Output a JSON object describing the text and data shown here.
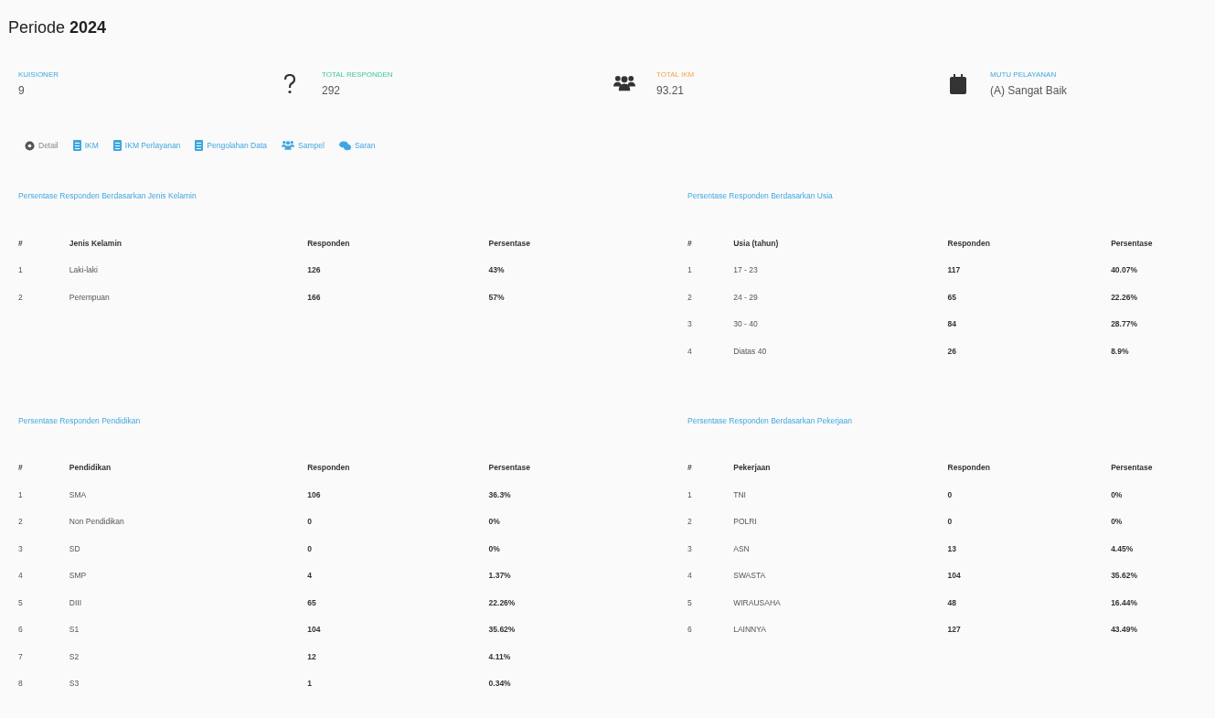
{
  "title": "Periode **2024**",
  "stats": [
    {
      "label": "KUISIONER",
      "value": "9"
    },
    {
      "label": "TOTAL RESPONDEN",
      "value": "292"
    },
    {
      "label": "TOTAL IKM",
      "value": "93.21"
    },
    {
      "label": "MUTU PELAYANAN",
      "value": "(A) Sangat Baik"
    }
  ],
  "nav": [
    {
      "label": "Detail",
      "selected": true
    },
    {
      "label": "IKM",
      "selected": false
    },
    {
      "label": "IKM Perlayanan",
      "selected": false
    },
    {
      "label": "Pengolahan Data",
      "selected": false
    },
    {
      "label": "Sampel",
      "selected": false
    },
    {
      "label": "Saran",
      "selected": false
    }
  ],
  "tables": [
    {
      "title": "Persentase Responden Berdasarkan Jenis Kelamin",
      "columns": [
        "#",
        "Jenis Kelamin",
        "Responden",
        "Persentase"
      ],
      "rows": [
        [
          "1",
          "Laki-laki",
          "126",
          "43%"
        ],
        [
          "2",
          "Perempuan",
          "166",
          "57%"
        ]
      ]
    },
    {
      "title": "Persentase Responden Berdasarkan Usia",
      "columns": [
        "#",
        "Usia (tahun)",
        "Responden",
        "Persentase"
      ],
      "rows": [
        [
          "1",
          "17 - 23",
          "117",
          "40.07%"
        ],
        [
          "2",
          "24 - 29",
          "65",
          "22.26%"
        ],
        [
          "3",
          "30 - 40",
          "84",
          "28.77%"
        ],
        [
          "4",
          "Diatas 40",
          "26",
          "8.9%"
        ]
      ]
    },
    {
      "title": "Persentase Responden Pendidikan",
      "columns": [
        "#",
        "Pendidikan",
        "Responden",
        "Persentase"
      ],
      "rows": [
        [
          "1",
          "SMA",
          "106",
          "36.3%"
        ],
        [
          "2",
          "Non Pendidikan",
          "0",
          "0%"
        ],
        [
          "3",
          "SD",
          "0",
          "0%"
        ],
        [
          "4",
          "SMP",
          "4",
          "1.37%"
        ],
        [
          "5",
          "DIII",
          "65",
          "22.26%"
        ],
        [
          "6",
          "S1",
          "104",
          "35.62%"
        ],
        [
          "7",
          "S2",
          "12",
          "4.11%"
        ],
        [
          "8",
          "S3",
          "1",
          "0.34%"
        ]
      ]
    },
    {
      "title": "Persentase Responden Berdasarkan Pekerjaan",
      "columns": [
        "#",
        "Pekerjaan",
        "Responden",
        "Persentase"
      ],
      "rows": [
        [
          "1",
          "TNI",
          "0",
          "0%"
        ],
        [
          "2",
          "POLRI",
          "0",
          "0%"
        ],
        [
          "3",
          "ASN",
          "13",
          "4.45%"
        ],
        [
          "4",
          "SWASTA",
          "104",
          "35.62%"
        ],
        [
          "5",
          "WIRAUSAHA",
          "48",
          "16.44%"
        ],
        [
          "6",
          "LAINNYA",
          "127",
          "43.49%"
        ]
      ]
    }
  ]
}
